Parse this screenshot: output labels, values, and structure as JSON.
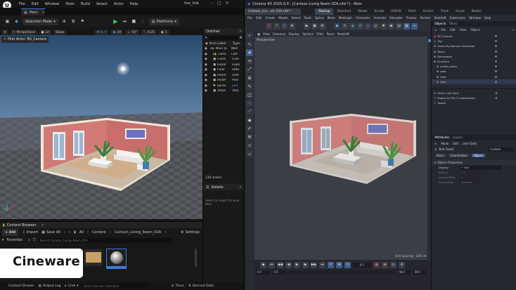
{
  "unreal": {
    "menu": [
      "File",
      "Edit",
      "Window",
      "Tools",
      "Build",
      "Select",
      "Actor",
      "Help"
    ],
    "project_name": "live_link",
    "map_tab": "Main",
    "toolbar": {
      "selection_mode": "Selection Mode",
      "platforms": "Platforms"
    },
    "viewport_bar": {
      "perspective": "Perspective",
      "lit": "Lit",
      "show": "Show",
      "grid_value": "10",
      "angle_value": "10°",
      "scale_value": "0.25",
      "camera_speed": "1"
    },
    "pilot_label": "Pilot Actor: RS_Camera",
    "outliner": {
      "title": "Outliner",
      "col_label": "Item Label",
      "col_type": "Type",
      "items": [
        {
          "label": "Main (E",
          "type": "Worl"
        },
        {
          "label": "Carto",
          "type": "Cart"
        },
        {
          "label": "CineC",
          "type": "Cine"
        },
        {
          "label": "Expor",
          "type": "Expo"
        },
        {
          "label": "Floor",
          "type": "Stati"
        },
        {
          "label": "Instar",
          "type": "Instr"
        },
        {
          "label": "PostP",
          "type": "Post"
        },
        {
          "label": "SunSl",
          "type": "Edit"
        },
        {
          "label": "Volun",
          "type": "Volu"
        }
      ],
      "count": "116 actors"
    },
    "details": {
      "title": "Details",
      "hint": "Select an object to view deta"
    },
    "content_browser": {
      "title": "Content Browser",
      "add": "+ Add",
      "import": "Import",
      "save_all": "Save All",
      "path": [
        "All",
        "Content",
        "Cartoon_Living_Room_02A"
      ],
      "settings": "Settings",
      "favorites": "Favorites",
      "search_placeholder": "Search Cartoon_Living_Room_02A"
    },
    "status": {
      "content_drawer": "Content Drawer",
      "output_log": "Output Log",
      "cmd": "Cmd",
      "console_placeholder": "Enter Console Command",
      "trace": "Trace",
      "derived_data": "Derived Data"
    }
  },
  "c4d": {
    "title": "Cinema 4D 2025.0.0 - [Cartoon Living Room 02A.c4d *] - Main",
    "doc_tabs": [
      "Cartoon_Livi...om 02A.c4d *"
    ],
    "layouts": [
      "Startup",
      "Standard",
      "Model",
      "Sculpt",
      "UVEdit",
      "Paint",
      "Groom",
      "Track",
      "Script",
      "Nodes"
    ],
    "menu": [
      "File",
      "Edit",
      "Create",
      "Modes",
      "Select",
      "Tools",
      "Spline",
      "Mesh",
      "MoGraph",
      "Character",
      "Animate",
      "Simulate",
      "Tracker",
      "Render",
      "Redshift",
      "Extensions",
      "Window",
      "Help"
    ],
    "viewport_menu": [
      "View",
      "Cameras",
      "Display",
      "Options",
      "Filter",
      "Panel",
      "Redshift"
    ],
    "viewport_name": "Perspective",
    "grid_spacing": "Grid Spacing : 100 cm",
    "objects_tabs": [
      "Objects",
      "Takes"
    ],
    "objects_menu": [
      "File",
      "Edit",
      "View",
      "Object"
    ],
    "objects": [
      "RS Camera",
      "Sky",
      "Scene By Dariusz Hentrique",
      "Room",
      "Decoration",
      "Furniture",
      "center_table",
      "sofa",
      "Seat",
      "Seat",
      "Direct Link Sync",
      "Export to File (*.udatasmith)",
      "About"
    ],
    "attr_tabs": [
      "Attributes",
      "Layers"
    ],
    "attr_menu": [
      "Mode",
      "Edit",
      "User Data"
    ],
    "attr_null": "Null [Seat]",
    "attr_custom": "Custom",
    "attr_subtabs": [
      "Basic",
      "Coordinates",
      "Object"
    ],
    "attr_section": "Object Properties",
    "attr_fields": [
      {
        "label": "Display",
        "value": "Dot"
      },
      {
        "label": "Radius",
        "value": "0.1"
      },
      {
        "label": "Aspect Ratio",
        "value": "1"
      },
      {
        "label": "Orientation",
        "value": "Camera"
      }
    ],
    "timeline": {
      "frame": "0 F",
      "start": "0 F",
      "end": "90 F",
      "current": "0 F",
      "max": "90 F"
    }
  },
  "badge": "Cineware"
}
